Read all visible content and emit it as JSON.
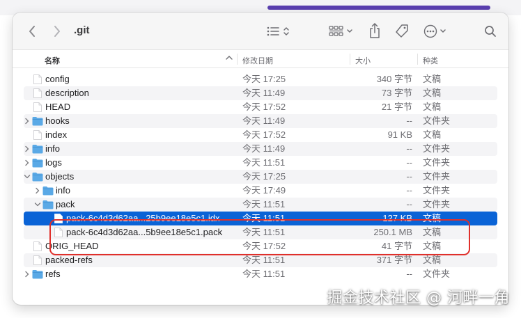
{
  "window": {
    "title": ".git"
  },
  "columns": {
    "name": "名称",
    "date": "修改日期",
    "size": "大小",
    "kind": "种类"
  },
  "rows": [
    {
      "name": "config",
      "date": "今天 17:25",
      "size": "340 字节",
      "kind": "文稿",
      "type": "file",
      "depth": 0
    },
    {
      "name": "description",
      "date": "今天 11:49",
      "size": "73 字节",
      "kind": "文稿",
      "type": "file",
      "depth": 0
    },
    {
      "name": "HEAD",
      "date": "今天 17:52",
      "size": "21 字节",
      "kind": "文稿",
      "type": "file",
      "depth": 0
    },
    {
      "name": "hooks",
      "date": "今天 11:49",
      "size": "--",
      "kind": "文件夹",
      "type": "folder",
      "depth": 0,
      "expanded": false
    },
    {
      "name": "index",
      "date": "今天 17:52",
      "size": "91 KB",
      "kind": "文稿",
      "type": "file",
      "depth": 0
    },
    {
      "name": "info",
      "date": "今天 11:49",
      "size": "--",
      "kind": "文件夹",
      "type": "folder",
      "depth": 0,
      "expanded": false
    },
    {
      "name": "logs",
      "date": "今天 11:51",
      "size": "--",
      "kind": "文件夹",
      "type": "folder",
      "depth": 0,
      "expanded": false
    },
    {
      "name": "objects",
      "date": "今天 17:25",
      "size": "--",
      "kind": "文件夹",
      "type": "folder",
      "depth": 0,
      "expanded": true
    },
    {
      "name": "info",
      "date": "今天 17:49",
      "size": "--",
      "kind": "文件夹",
      "type": "folder",
      "depth": 1,
      "expanded": false
    },
    {
      "name": "pack",
      "date": "今天 11:51",
      "size": "--",
      "kind": "文件夹",
      "type": "folder",
      "depth": 1,
      "expanded": true
    },
    {
      "name": "pack-6c4d3d62aa...25b9ee18e5c1.idx",
      "date": "今天 11:51",
      "size": "127 KB",
      "kind": "文稿",
      "type": "file",
      "depth": 2,
      "selected": true
    },
    {
      "name": "pack-6c4d3d62aa...5b9ee18e5c1.pack",
      "date": "今天 11:51",
      "size": "250.1 MB",
      "kind": "文稿",
      "type": "file",
      "depth": 2
    },
    {
      "name": "ORIG_HEAD",
      "date": "今天 17:52",
      "size": "41 字节",
      "kind": "文稿",
      "type": "file",
      "depth": 0
    },
    {
      "name": "packed-refs",
      "date": "今天 11:51",
      "size": "371 字节",
      "kind": "文稿",
      "type": "file",
      "depth": 0
    },
    {
      "name": "refs",
      "date": "今天 11:51",
      "size": "--",
      "kind": "文件夹",
      "type": "folder",
      "depth": 0,
      "expanded": false
    }
  ],
  "watermark": "掘金技术社区 @ 河畔一角",
  "colors": {
    "selection": "#0a63d6",
    "folder": "#5aa9e6",
    "annotation": "#e0302b"
  },
  "icons": [
    "back-icon",
    "forward-icon",
    "list-view-icon",
    "group-icon",
    "share-icon",
    "tag-icon",
    "more-icon",
    "search-icon"
  ]
}
